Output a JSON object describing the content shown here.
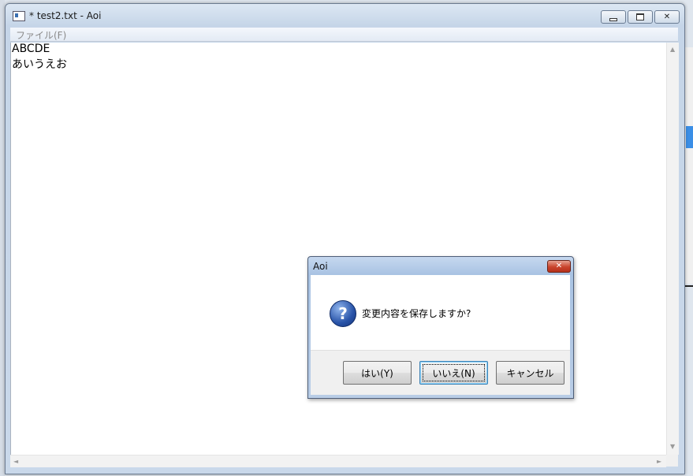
{
  "window": {
    "title": "* test2.txt - Aoi",
    "icon": "notepad-icon",
    "caption_buttons": {
      "minimize": "minimize-icon",
      "maximize": "maximize-icon",
      "close": "✕"
    }
  },
  "menu": {
    "items": [
      {
        "label": "ファイル(F)"
      }
    ]
  },
  "editor": {
    "lines": [
      "ABCDE",
      "あいうえお"
    ]
  },
  "scrollbars": {
    "up": "▲",
    "down": "▼",
    "left": "◄",
    "right": "►"
  },
  "dialog": {
    "title": "Aoi",
    "close": "✕",
    "icon": "question-icon",
    "icon_glyph": "?",
    "message": "変更内容を保存しますか?",
    "buttons": {
      "yes": "はい(Y)",
      "no": "いいえ(N)",
      "cancel": "キャンセル"
    },
    "default_button": "no"
  },
  "colors": {
    "dialog_close": "#c9452d",
    "question_icon": "#2853a8",
    "default_button_border": "#3c7fb1"
  }
}
